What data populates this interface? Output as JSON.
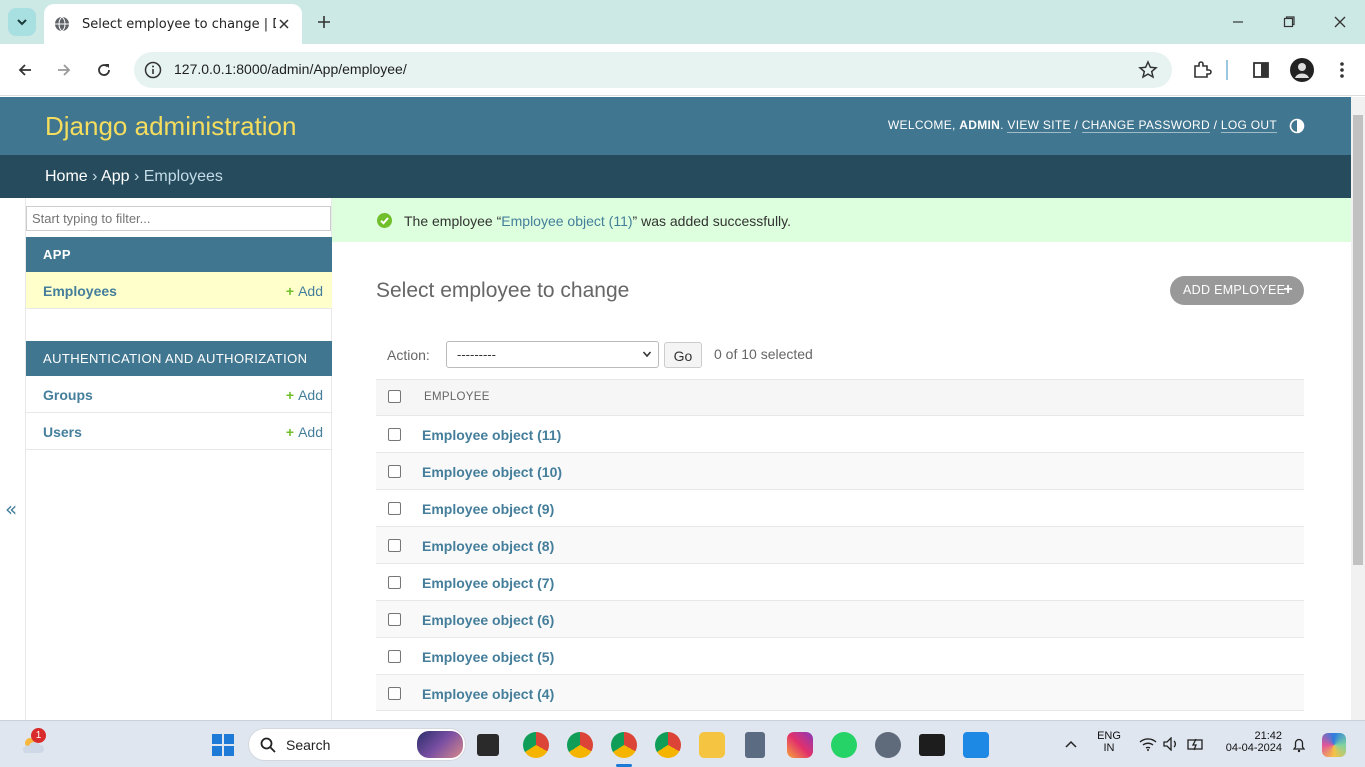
{
  "browser": {
    "tab_title": "Select employee to change | Dj",
    "url": "127.0.0.1:8000/admin/App/employee/"
  },
  "header": {
    "brand": "Django administration",
    "welcome": "WELCOME, ",
    "username": "ADMIN",
    "view_site": "VIEW SITE",
    "change_password": "CHANGE PASSWORD",
    "log_out": "LOG OUT"
  },
  "breadcrumbs": {
    "home": "Home",
    "app": "App",
    "current": "Employees",
    "sep": "›"
  },
  "sidebar": {
    "filter_placeholder": "Start typing to filter...",
    "sections": [
      {
        "caption": "APP",
        "items": [
          {
            "label": "Employees",
            "add": "Add"
          }
        ]
      },
      {
        "caption": "AUTHENTICATION AND AUTHORIZATION",
        "items": [
          {
            "label": "Groups",
            "add": "Add"
          },
          {
            "label": "Users",
            "add": "Add"
          }
        ]
      }
    ],
    "collapse": "«"
  },
  "message": {
    "prefix": "The employee “",
    "link": "Employee object (11)",
    "suffix": "” was added successfully."
  },
  "main": {
    "title": "Select employee to change",
    "add_button": "ADD EMPLOYEE",
    "action_label": "Action:",
    "action_selected": "---------",
    "go": "Go",
    "selected_count": "0 of 10 selected",
    "column_header": "EMPLOYEE",
    "rows": [
      "Employee object (11)",
      "Employee object (10)",
      "Employee object (9)",
      "Employee object (8)",
      "Employee object (7)",
      "Employee object (6)",
      "Employee object (5)",
      "Employee object (4)"
    ]
  },
  "taskbar": {
    "search": "Search",
    "lang_top": "ENG",
    "lang_bottom": "IN",
    "time": "21:42",
    "date": "04-04-2024",
    "weather_badge": "1"
  },
  "colors": {
    "header_bg": "#417690",
    "breadcrumb_bg": "#264b5d",
    "brand_yellow": "#f5dd5d",
    "link_blue": "#447e9b",
    "success_bg": "#dddddd"
  }
}
